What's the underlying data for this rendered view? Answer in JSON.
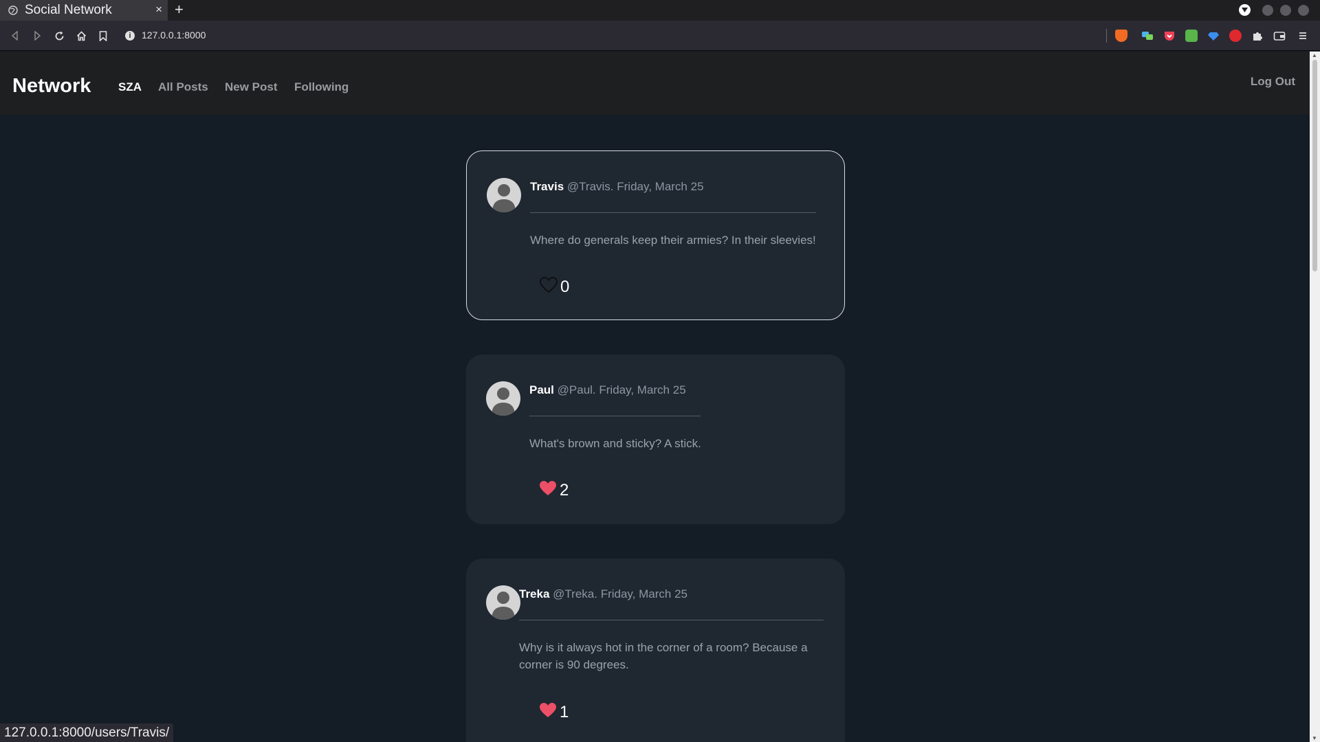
{
  "browser": {
    "tab_title": "Social Network",
    "tab_close": "×",
    "new_tab": "+",
    "url": "127.0.0.1:8000",
    "info": "i",
    "status_url": "127.0.0.1:8000/users/Travis/"
  },
  "navbar": {
    "brand": "Network",
    "links": [
      "SZA",
      "All Posts",
      "New Post",
      "Following"
    ],
    "active_link": "SZA",
    "logout": "Log Out"
  },
  "posts": [
    {
      "author": "Travis",
      "meta": "@Travis. Friday, March 25",
      "content": "Where do generals keep their armies? In their sleevies!",
      "likes": "0",
      "liked": false
    },
    {
      "author": "Paul",
      "meta": "@Paul. Friday, March 25",
      "content": "What's brown and sticky? A stick.",
      "likes": "2",
      "liked": true
    },
    {
      "author": "Treka",
      "meta": "@Treka. Friday, March 25",
      "content": "Why is it always hot in the corner of a room? Because a corner is 90 degrees.",
      "likes": "1",
      "liked": true
    }
  ],
  "colors": {
    "page_bg": "#141c26",
    "card_bg": "#1f2731",
    "navbar_bg": "#1e1f21",
    "heart_liked": "#ec4f66",
    "muted_text": "#8d96a1"
  },
  "icons": {
    "back": "back-arrow-icon",
    "forward": "forward-arrow-icon",
    "reload": "reload-icon",
    "home": "home-icon",
    "bookmark": "bookmark-icon",
    "heart": "heart-icon",
    "avatar": "default-avatar-icon"
  }
}
